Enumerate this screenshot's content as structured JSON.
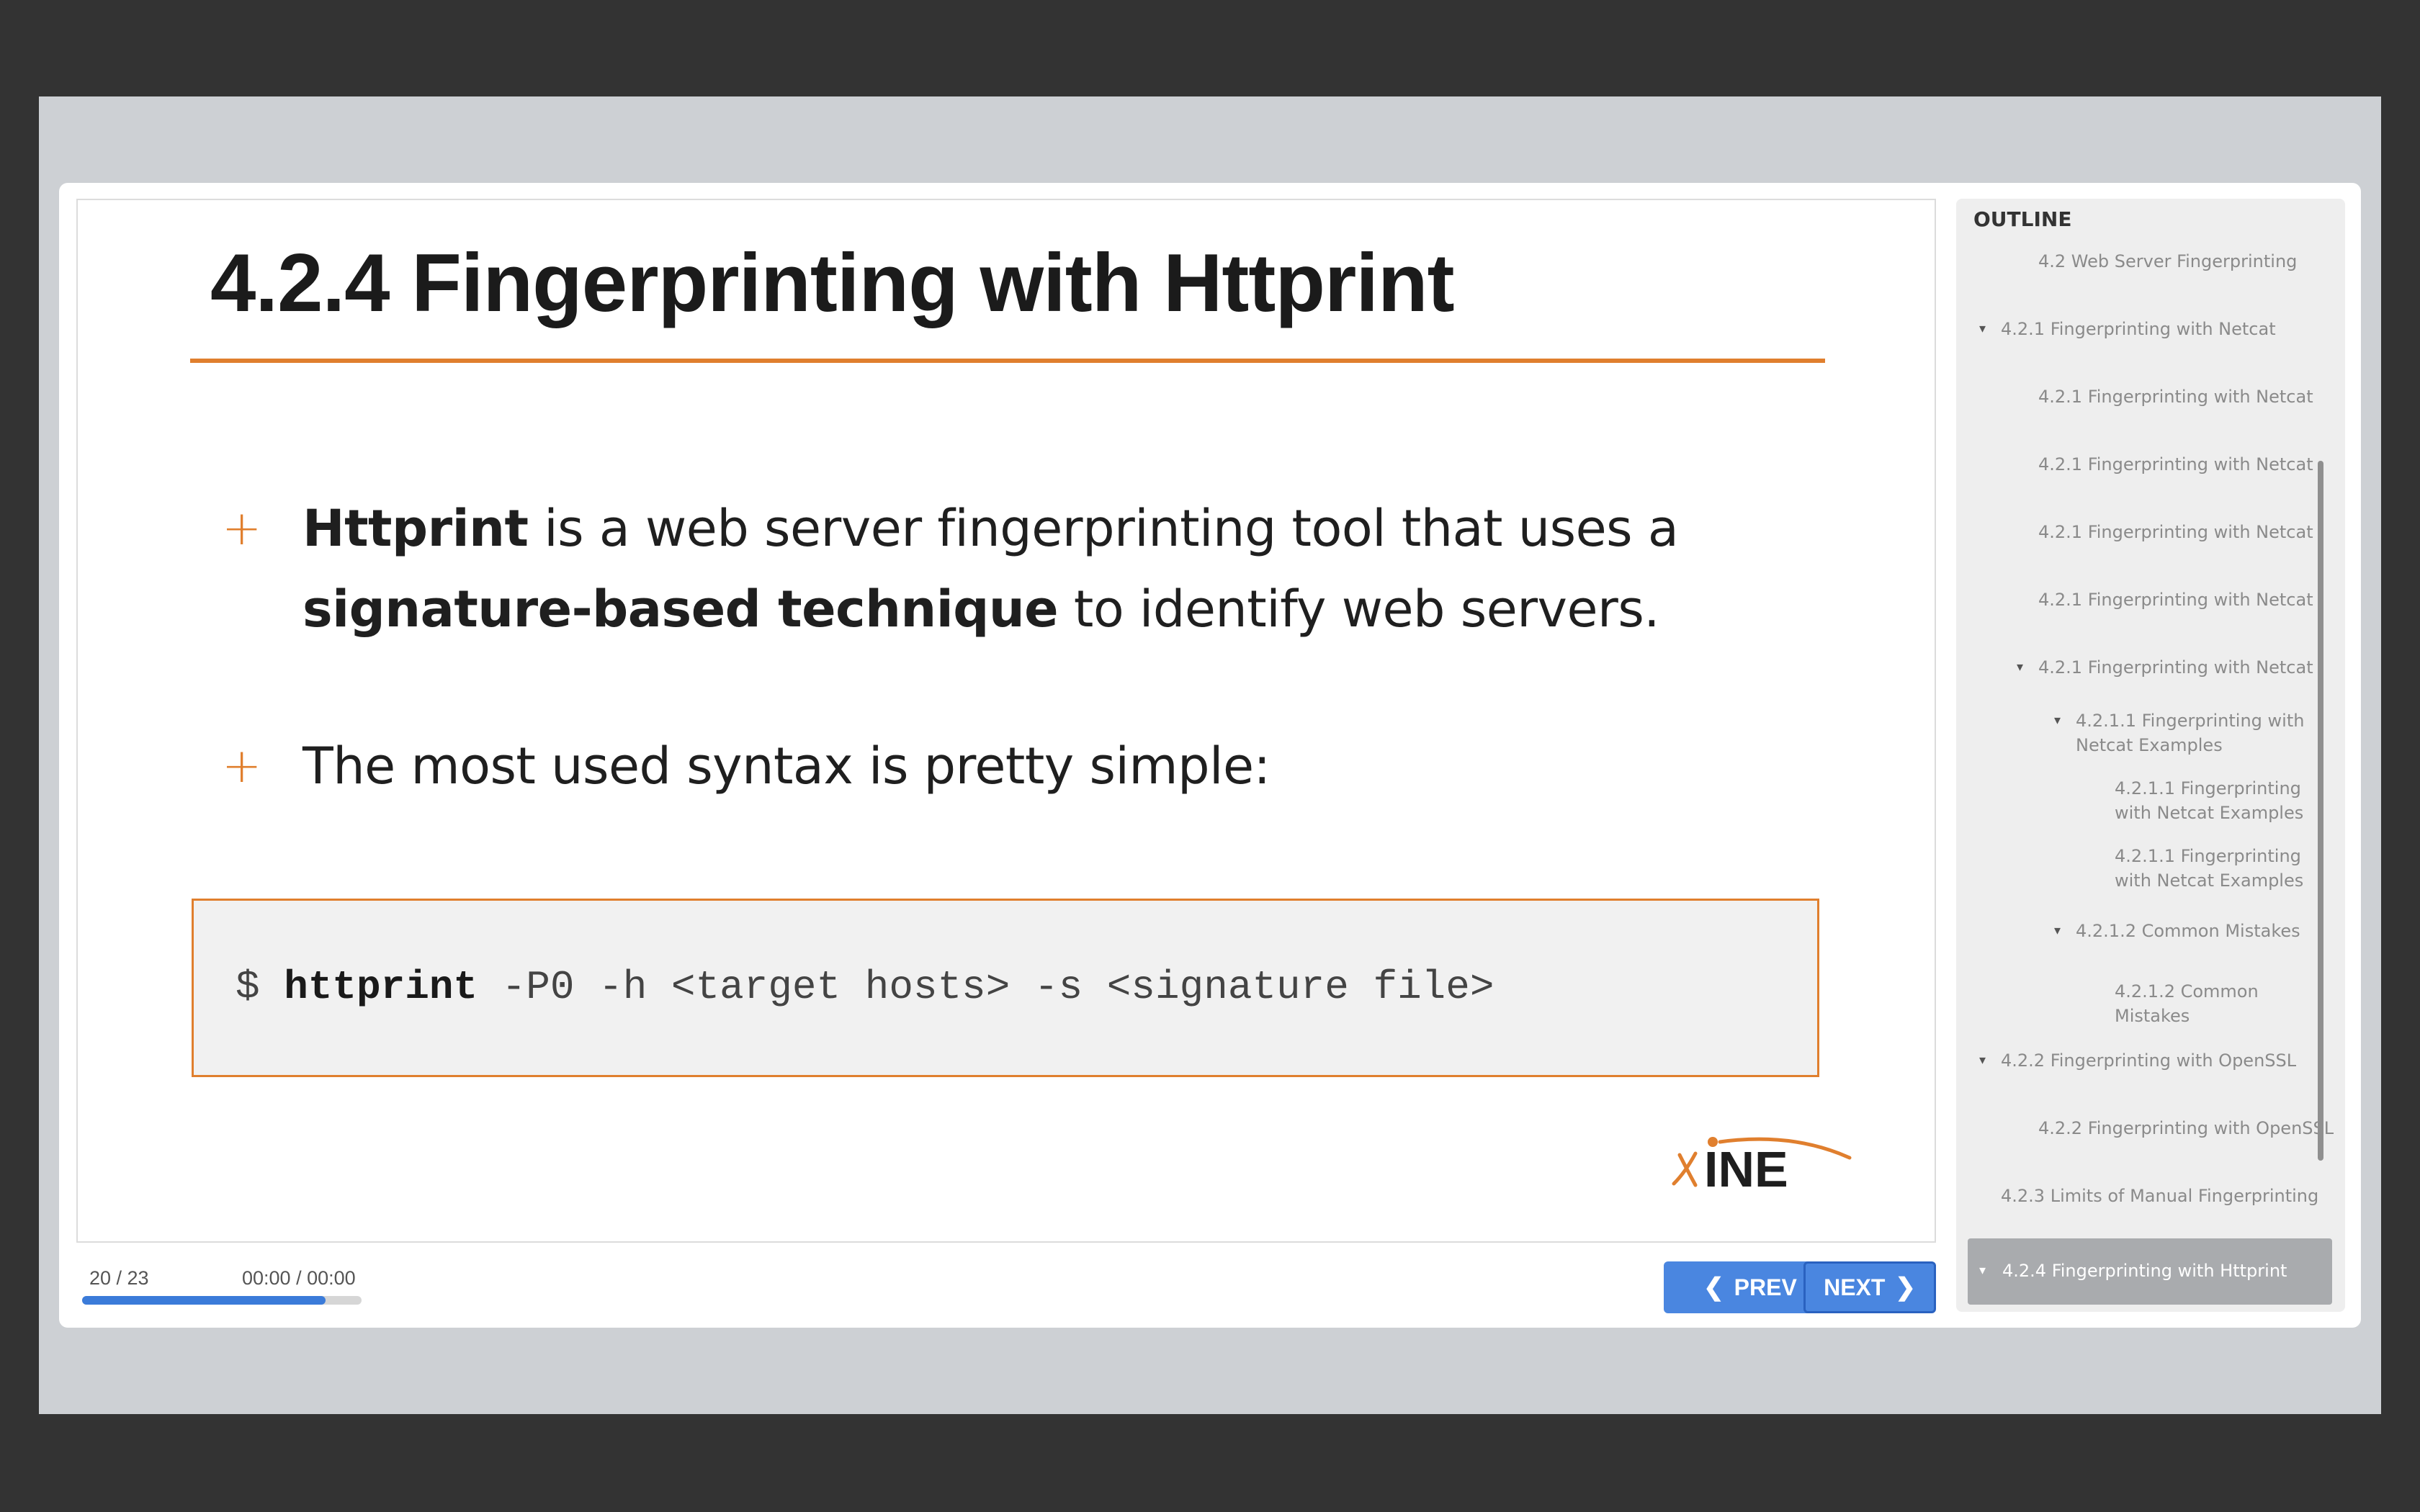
{
  "slide": {
    "title": "4.2.4 Fingerprinting with Httprint",
    "bullets": [
      {
        "bold": "Httprint",
        "text1": " is a web server fingerprinting tool that uses a ",
        "bold2": "signature-based technique",
        "text2": " to identify web servers."
      },
      {
        "text": "The most used syntax is pretty simple:"
      }
    ],
    "code": {
      "prompt": "$ ",
      "command": "httprint",
      "args": " -P0 -h <target hosts> -s <signature file>"
    },
    "logo": "INE"
  },
  "player": {
    "slide_count": "20 / 23",
    "time": "00:00 / 00:00",
    "progress": 0.87,
    "prev_label": "PREV",
    "next_label": "NEXT"
  },
  "outline": {
    "title": "OUTLINE",
    "items": [
      {
        "label": "4.2 Web Server Fingerprinting",
        "caret": false
      },
      {
        "label": "4.2.1 Fingerprinting with Netcat",
        "caret": true
      },
      {
        "label": "4.2.1 Fingerprinting with Netcat",
        "caret": false
      },
      {
        "label": "4.2.1 Fingerprinting with Netcat",
        "caret": false
      },
      {
        "label": "4.2.1 Fingerprinting with Netcat",
        "caret": false
      },
      {
        "label": "4.2.1 Fingerprinting with Netcat",
        "caret": false
      },
      {
        "label": "4.2.1 Fingerprinting with Netcat",
        "caret": true
      },
      {
        "label": "4.2.1.1 Fingerprinting with Netcat Examples",
        "caret": true
      },
      {
        "label": "4.2.1.1 Fingerprinting with Netcat Examples",
        "caret": false
      },
      {
        "label": "4.2.1.1 Fingerprinting with Netcat Examples",
        "caret": false
      },
      {
        "label": "4.2.1.2 Common Mistakes",
        "caret": true
      },
      {
        "label": "4.2.1.2 Common Mistakes",
        "caret": false
      },
      {
        "label": "4.2.2 Fingerprinting with OpenSSL",
        "caret": true
      },
      {
        "label": "4.2.2 Fingerprinting with OpenSSL",
        "caret": false
      },
      {
        "label": "4.2.3 Limits of Manual Fingerprinting",
        "caret": false
      },
      {
        "label": "4.2.4 Fingerprinting with Httprint",
        "caret": true,
        "current": true
      }
    ]
  }
}
